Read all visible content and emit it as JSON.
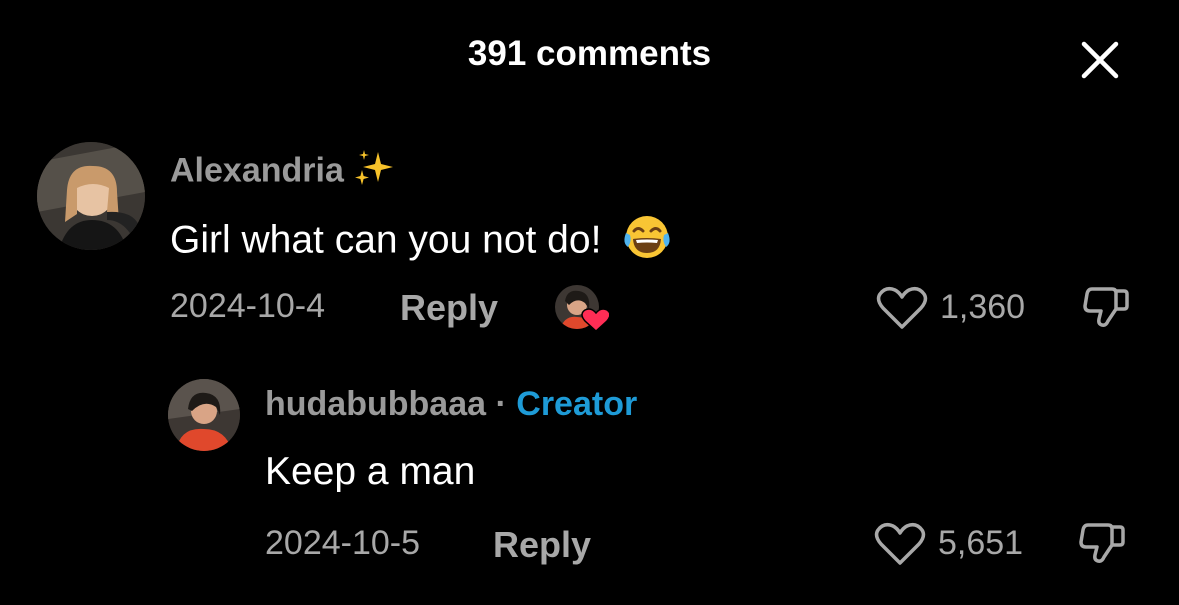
{
  "header": {
    "title": "391 comments"
  },
  "comments": [
    {
      "username": "Alexandria",
      "text": "Girl what can you not do! ",
      "date": "2024-10-4",
      "reply_label": "Reply",
      "likes": "1,360",
      "liked_by_creator": true
    }
  ],
  "replies": [
    {
      "username": "hudabubbaaa",
      "separator": "·",
      "badge": "Creator",
      "text": "Keep a man",
      "date": "2024-10-5",
      "reply_label": "Reply",
      "likes": "5,651"
    }
  ],
  "colors": {
    "background": "#000000",
    "creator_badge": "#1e9bd7",
    "heart": "#ff2d55",
    "muted": "#a8a8a8"
  },
  "icons": [
    "close-icon",
    "sparkles-emoji",
    "laughing-emoji",
    "heart-icon",
    "dislike-icon",
    "creator-liked-badge"
  ]
}
